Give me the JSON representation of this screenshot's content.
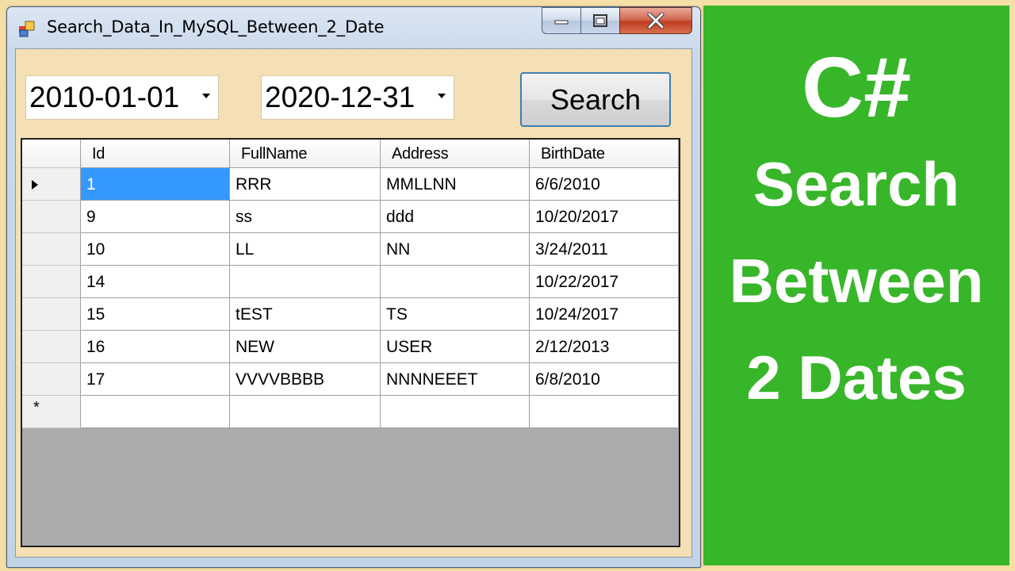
{
  "window": {
    "title": "Search_Data_In_MySQL_Between_2_Date"
  },
  "controls": {
    "date_from": "2010-01-01",
    "date_to": "2020-12-31",
    "search_label": "Search"
  },
  "grid": {
    "columns": [
      "Id",
      "FullName",
      "Address",
      "BirthDate"
    ],
    "rows": [
      [
        "1",
        "RRR",
        "MMLLNN",
        "6/6/2010"
      ],
      [
        "9",
        "ss",
        "ddd",
        "10/20/2017"
      ],
      [
        "10",
        "LL",
        "NN",
        "3/24/2011"
      ],
      [
        "14",
        "",
        "",
        "10/22/2017"
      ],
      [
        "15",
        "tEST",
        "TS",
        "10/24/2017"
      ],
      [
        "16",
        "NEW",
        "USER",
        "2/12/2013"
      ],
      [
        "17",
        "VVVVBBBB",
        "NNNNEEET",
        "6/8/2010"
      ]
    ],
    "new_row_marker": "*"
  },
  "banner": {
    "line1": "C#",
    "line2": "Search",
    "line3": "Between",
    "line4": "2 Dates",
    "background": "#38b62a"
  }
}
